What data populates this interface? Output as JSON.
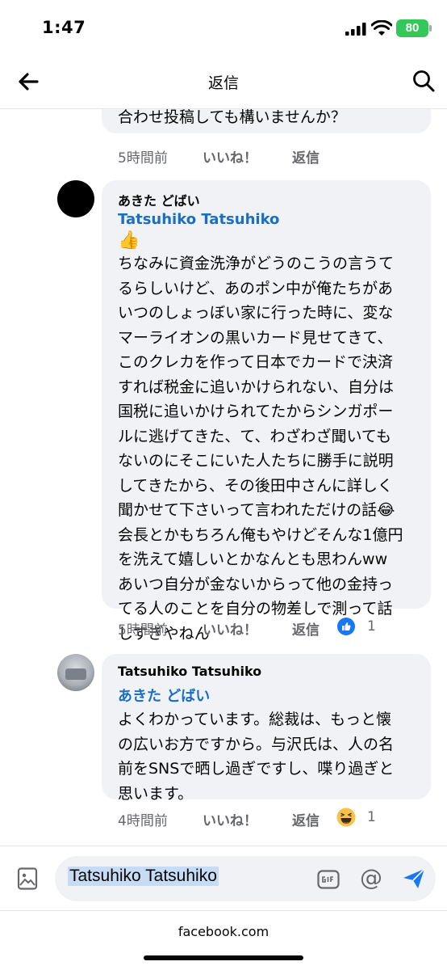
{
  "status_bar": {
    "time": "1:47",
    "battery": "80"
  },
  "nav": {
    "title": "返信",
    "back_icon": "arrow-left-icon",
    "search_icon": "search-icon"
  },
  "comments": [
    {
      "text": "合わせ投稿しても構いませんか？",
      "time": "5時間前",
      "like": "いいね！",
      "reply": "返信"
    },
    {
      "author": "あきた どばい",
      "tag": "Tatsuhiko Tatsuhiko",
      "emoji": "👍",
      "text": "ちなみに資金洗浄がどうのこうの言うて\nるらしいけど、あのポン中が俺たちがあ\nいつのしょっぼい家に行った時に、変な\nマーライオンの黒いカード見せてきて、\nこのクレカを作って日本でカードで決済\nすれば税金に追いかけられない、自分は\n国税に追いかけられてたからシンガポー\nルに逃げてきた、て、わざわざ聞いても\nないのにそこにいた人たちに勝手に説明\nしてきたから、その後田中さんに詳しく\n聞かせて下さいって言われただけの話😂\n会長とかもちろん俺もやけどそんな1億円\nを洗えて嬉しいとかなんとも思わんww\nあいつ自分が金ないからって他の金持っ\nてる人のことを自分の物差しで測って話\nしすぎやねん",
      "time": "5時間前",
      "like": "いいね！",
      "reply": "返信",
      "reaction": "thumbs-up",
      "reaction_count": "1"
    },
    {
      "author": "Tatsuhiko Tatsuhiko",
      "tag": "あきた どばい",
      "text": "よくわかっています。総裁は、もっと懐\nの広いお方ですから。与沢氏は、人の名\n前をSNSで晒し過ぎですし、喋り過ぎと\n思います。",
      "time": "4時間前",
      "like": "いいね！",
      "reply": "返信",
      "reaction": "haha",
      "reaction_count": "1"
    }
  ],
  "composer": {
    "value": "Tatsuhiko Tatsuhiko",
    "at_symbol": "@"
  },
  "footer": {
    "url": "facebook.com"
  },
  "colors": {
    "accent": "#1877f2",
    "tag": "#1b6ec2",
    "bubble": "#f0f2f5",
    "muted": "#65676b"
  }
}
